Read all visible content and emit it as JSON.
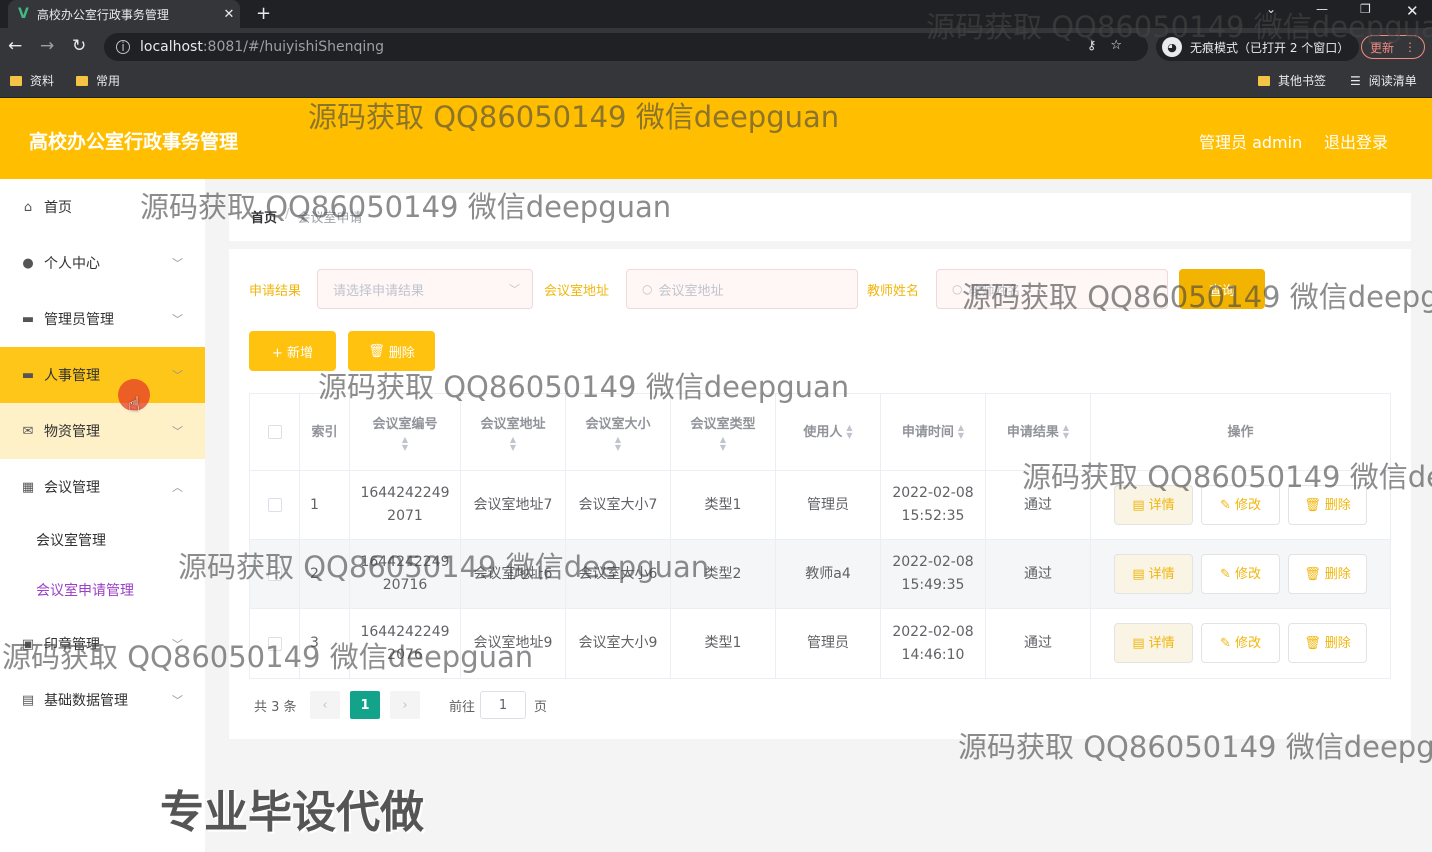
{
  "browser": {
    "tab_title": "高校办公室行政事务管理",
    "url_host": "localhost",
    "url_path": ":8081/#/huiyishiShenqing",
    "incognito_label": "无痕模式（已打开 2 个窗口）",
    "update_label": "更新",
    "bookmarks": [
      "资料",
      "常用"
    ],
    "bookmarks_right": [
      "其他书签",
      "阅读清单"
    ]
  },
  "header": {
    "title": "高校办公室行政事务管理",
    "admin_label": "管理员 admin",
    "logout_label": "退出登录",
    "bg_color": "#ffbf00"
  },
  "sidebar": {
    "items": [
      {
        "label": "首页",
        "icon": "home-icon"
      },
      {
        "label": "个人中心",
        "icon": "user-icon"
      },
      {
        "label": "管理员管理",
        "icon": "briefcase-icon"
      },
      {
        "label": "人事管理",
        "icon": "folder-icon"
      },
      {
        "label": "物资管理",
        "icon": "mail-icon"
      },
      {
        "label": "会议管理",
        "icon": "grid-icon"
      },
      {
        "label": "会议室管理"
      },
      {
        "label": "会议室申请管理"
      },
      {
        "label": "印章管理",
        "icon": "stamp-icon"
      },
      {
        "label": "基础数据管理",
        "icon": "clipboard-icon"
      }
    ]
  },
  "breadcrumb": {
    "home": "首页",
    "current": "会议室申请"
  },
  "filters": {
    "result_label": "申请结果",
    "result_placeholder": "请选择申请结果",
    "address_label": "会议室地址",
    "address_placeholder": "会议室地址",
    "teacher_label": "教师姓名",
    "teacher_placeholder": "教师姓名",
    "search_label": "查询"
  },
  "actions": {
    "add_label": "+ 新增",
    "delete_label": "删除"
  },
  "table": {
    "headers": [
      "索引",
      "会议室编号",
      "会议室地址",
      "会议室大小",
      "会议室类型",
      "使用人",
      "申请时间",
      "申请结果",
      "操作"
    ],
    "rows": [
      {
        "index": "1",
        "code1": "1644242249",
        "code2": "2071",
        "address": "会议室地址7",
        "size": "会议室大小7",
        "type": "类型1",
        "user": "管理员",
        "date": "2022-02-08",
        "time": "15:52:35",
        "result": "通过"
      },
      {
        "index": "2",
        "code1": "1644242249",
        "code2": "20716",
        "address": "会议室地址6",
        "size": "会议室大小6",
        "type": "类型2",
        "user": "教师a4",
        "date": "2022-02-08",
        "time": "15:49:35",
        "result": "通过"
      },
      {
        "index": "3",
        "code1": "1644242249",
        "code2": "2076",
        "address": "会议室地址9",
        "size": "会议室大小9",
        "type": "类型1",
        "user": "管理员",
        "date": "2022-02-08",
        "time": "14:46:10",
        "result": "通过"
      }
    ],
    "op_detail": "详情",
    "op_edit": "修改",
    "op_delete": "删除"
  },
  "pagination": {
    "total": "共 3 条",
    "current": "1",
    "goto_label": "前往",
    "goto_value": "1",
    "page_suffix": "页"
  },
  "watermarks": {
    "text": "源码获取 QQ86050149 微信deepguan",
    "text_partial": "源码获取 QQ86050149 微信deepg",
    "banner": "专业毕设代做"
  }
}
